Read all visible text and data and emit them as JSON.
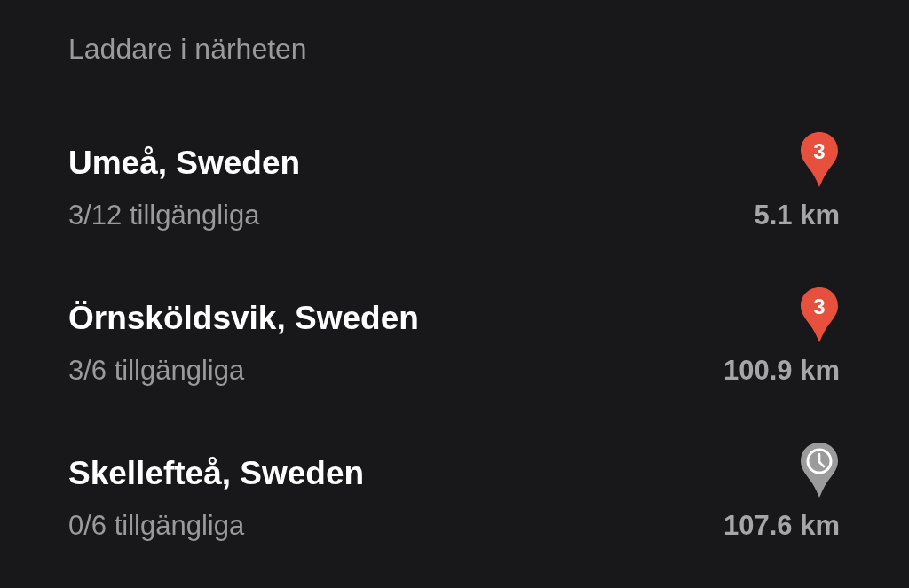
{
  "heading": "Laddare i närheten",
  "chargers": [
    {
      "name": "Umeå, Sweden",
      "availability": "3/12 tillgängliga",
      "distance": "5.1 km",
      "pin": {
        "kind": "count",
        "label": "3"
      }
    },
    {
      "name": "Örnsköldsvik, Sweden",
      "availability": "3/6 tillgängliga",
      "distance": "100.9 km",
      "pin": {
        "kind": "count",
        "label": "3"
      }
    },
    {
      "name": "Skellefteå, Sweden",
      "availability": "0/6 tillgängliga",
      "distance": "107.6 km",
      "pin": {
        "kind": "clock"
      }
    }
  ]
}
